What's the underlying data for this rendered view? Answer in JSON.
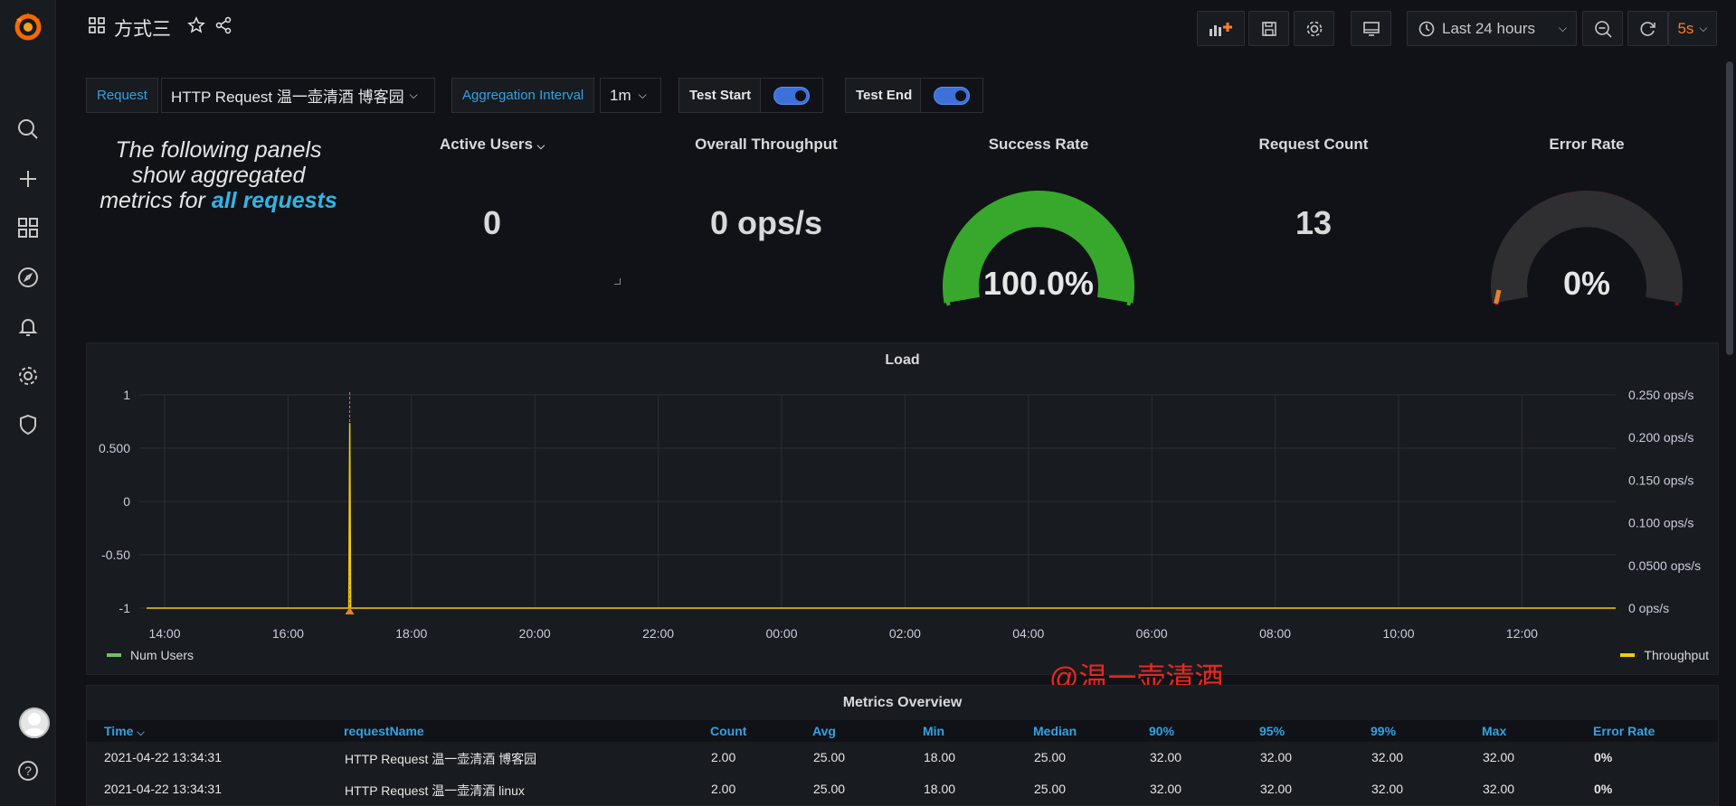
{
  "dashboard": {
    "title": "方式三"
  },
  "time_picker": {
    "label": "Last 24 hours"
  },
  "refresh": {
    "interval": "5s"
  },
  "variables": {
    "request_label": "Request",
    "request_value": "HTTP Request 温一壶清酒 博客园",
    "agg_label": "Aggregation Interval",
    "agg_value": "1m",
    "test_start_label": "Test Start",
    "test_end_label": "Test End"
  },
  "intro": {
    "line1": "The following panels",
    "line2": "show aggregated",
    "line3_prefix": "metrics for ",
    "line3_highlight": "all requests"
  },
  "stats": {
    "active_users": {
      "title": "Active Users",
      "value": "0"
    },
    "throughput": {
      "title": "Overall Throughput",
      "value": "0 ops/s"
    },
    "success_rate": {
      "title": "Success Rate",
      "value": "100.0%",
      "fraction": 1.0,
      "color": "#37a82c"
    },
    "request_count": {
      "title": "Request Count",
      "value": "13"
    },
    "error_rate": {
      "title": "Error Rate",
      "value": "0%",
      "fraction": 0.0,
      "color": "#8b0f0f"
    }
  },
  "chart_data": {
    "type": "line",
    "title": "Load",
    "x": [
      "14:00",
      "16:00",
      "18:00",
      "20:00",
      "22:00",
      "00:00",
      "02:00",
      "04:00",
      "06:00",
      "08:00",
      "10:00",
      "12:00"
    ],
    "y_left_ticks": [
      "1",
      "0.500",
      "0",
      "-0.50",
      "-1"
    ],
    "y_right_ticks": [
      "0.250 ops/s",
      "0.200 ops/s",
      "0.150 ops/s",
      "0.100 ops/s",
      "0.0500 ops/s",
      "0 ops/s"
    ],
    "ylim_left": [
      -1,
      1
    ],
    "ylim_right": [
      0,
      0.25
    ],
    "series": [
      {
        "name": "Num Users",
        "color": "#73bf69",
        "axis": "left"
      },
      {
        "name": "Throughput",
        "color": "#f2cc0c",
        "axis": "right",
        "points": [
          {
            "x": "17:00",
            "y": 0.217
          }
        ]
      }
    ],
    "grid": true,
    "legend": "bottom"
  },
  "metrics": {
    "title": "Metrics Overview",
    "columns": [
      "Time",
      "requestName",
      "Count",
      "Avg",
      "Min",
      "Median",
      "90%",
      "95%",
      "99%",
      "Max",
      "Error Rate"
    ],
    "rows": [
      [
        "2021-04-22 13:34:31",
        "HTTP Request 温一壶清酒 博客园",
        "2.00",
        "25.00",
        "18.00",
        "25.00",
        "32.00",
        "32.00",
        "32.00",
        "32.00",
        "0%"
      ],
      [
        "2021-04-22 13:34:31",
        "HTTP Request 温一壶清酒 linux",
        "2.00",
        "25.00",
        "18.00",
        "25.00",
        "32.00",
        "32.00",
        "32.00",
        "32.00",
        "0%"
      ]
    ]
  },
  "watermark": "@温一壶清酒",
  "colors": {
    "accent": "#33a2e5",
    "refresh": "#ff7c2b",
    "success": "#37a82c",
    "error": "#8b0f0f"
  }
}
